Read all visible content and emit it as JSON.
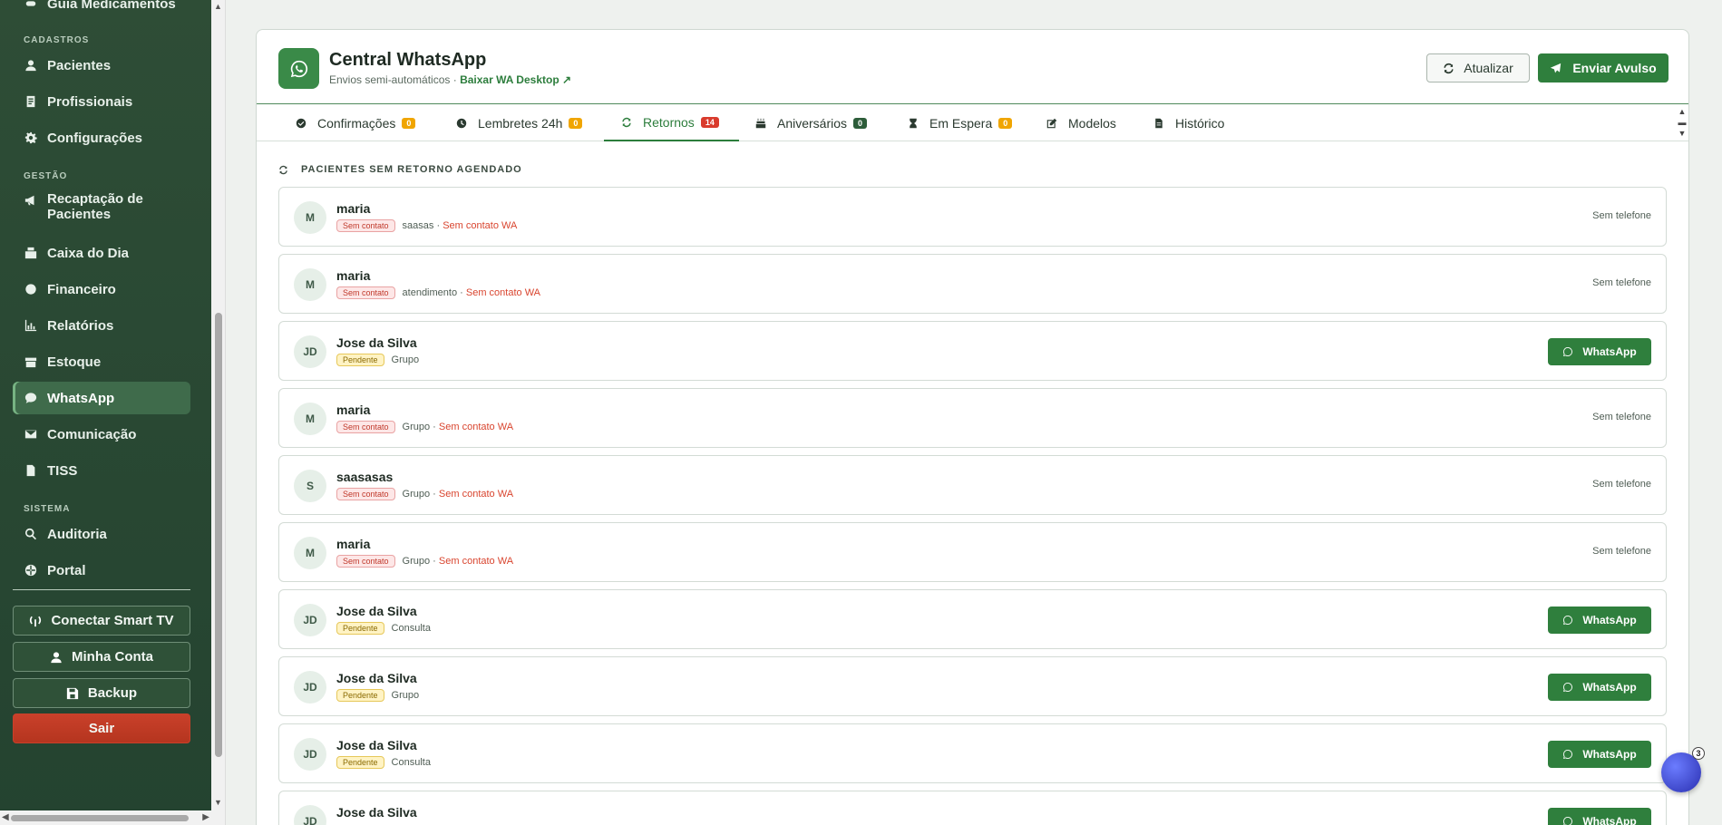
{
  "sidebar": {
    "partial_item": "Guia Medicamentos",
    "sections": {
      "cadastros": "CADASTROS",
      "gestao": "GESTÃO",
      "sistema": "SISTEMA"
    },
    "items": {
      "pacientes": "Pacientes",
      "profissionais": "Profissionais",
      "configuracoes": "Configurações",
      "recaptacao": "Recaptação de Pacientes",
      "caixa": "Caixa do Dia",
      "financeiro": "Financeiro",
      "relatorios": "Relatórios",
      "estoque": "Estoque",
      "whatsapp": "WhatsApp",
      "comunicacao": "Comunicação",
      "tiss": "TISS",
      "auditoria": "Auditoria",
      "portal": "Portal"
    },
    "buttons": {
      "smart_tv": "Conectar Smart TV",
      "minha_conta": "Minha Conta",
      "backup": "Backup",
      "sair": "Sair"
    }
  },
  "header": {
    "title": "Central WhatsApp",
    "subtitle": "Envios semi-automáticos ·",
    "download_link": "Baixar WA Desktop ↗",
    "refresh_label": "Atualizar",
    "send_label": "Enviar Avulso"
  },
  "tabs": [
    {
      "label": "Confirmações",
      "count": "0"
    },
    {
      "label": "Lembretes 24h",
      "count": "0"
    },
    {
      "label": "Retornos",
      "count": "14"
    },
    {
      "label": "Aniversários",
      "count": "0"
    },
    {
      "label": "Em Espera",
      "count": "0"
    },
    {
      "label": "Modelos",
      "count": ""
    },
    {
      "label": "Histórico",
      "count": ""
    }
  ],
  "section_title": "PACIENTES SEM RETORNO AGENDADO",
  "labels": {
    "sem_telefone": "Sem telefone",
    "whatsapp": "WhatsApp",
    "sem_contato_wa": "Sem contato WA"
  },
  "patients": [
    {
      "initials": "M",
      "name": "maria",
      "status": "Sem contato",
      "type": "saasas",
      "sep": "·"
    },
    {
      "initials": "M",
      "name": "maria",
      "status": "Sem contato",
      "type": "atendimento",
      "sep": "·"
    },
    {
      "initials": "JD",
      "name": "Jose da Silva",
      "status": "Pendente",
      "type": "Grupo"
    },
    {
      "initials": "M",
      "name": "maria",
      "status": "Sem contato",
      "type": "Grupo",
      "sep": "·"
    },
    {
      "initials": "S",
      "name": "saasasas",
      "status": "Sem contato",
      "type": "Grupo",
      "sep": "·"
    },
    {
      "initials": "M",
      "name": "maria",
      "status": "Sem contato",
      "type": "Grupo",
      "sep": "·"
    },
    {
      "initials": "JD",
      "name": "Jose da Silva",
      "status": "Pendente",
      "type": "Consulta"
    },
    {
      "initials": "JD",
      "name": "Jose da Silva",
      "status": "Pendente",
      "type": "Grupo"
    },
    {
      "initials": "JD",
      "name": "Jose da Silva",
      "status": "Pendente",
      "type": "Consulta"
    },
    {
      "initials": "JD",
      "name": "Jose da Silva",
      "status": "",
      "type": ""
    }
  ],
  "chat_widget": {
    "count": "3"
  }
}
